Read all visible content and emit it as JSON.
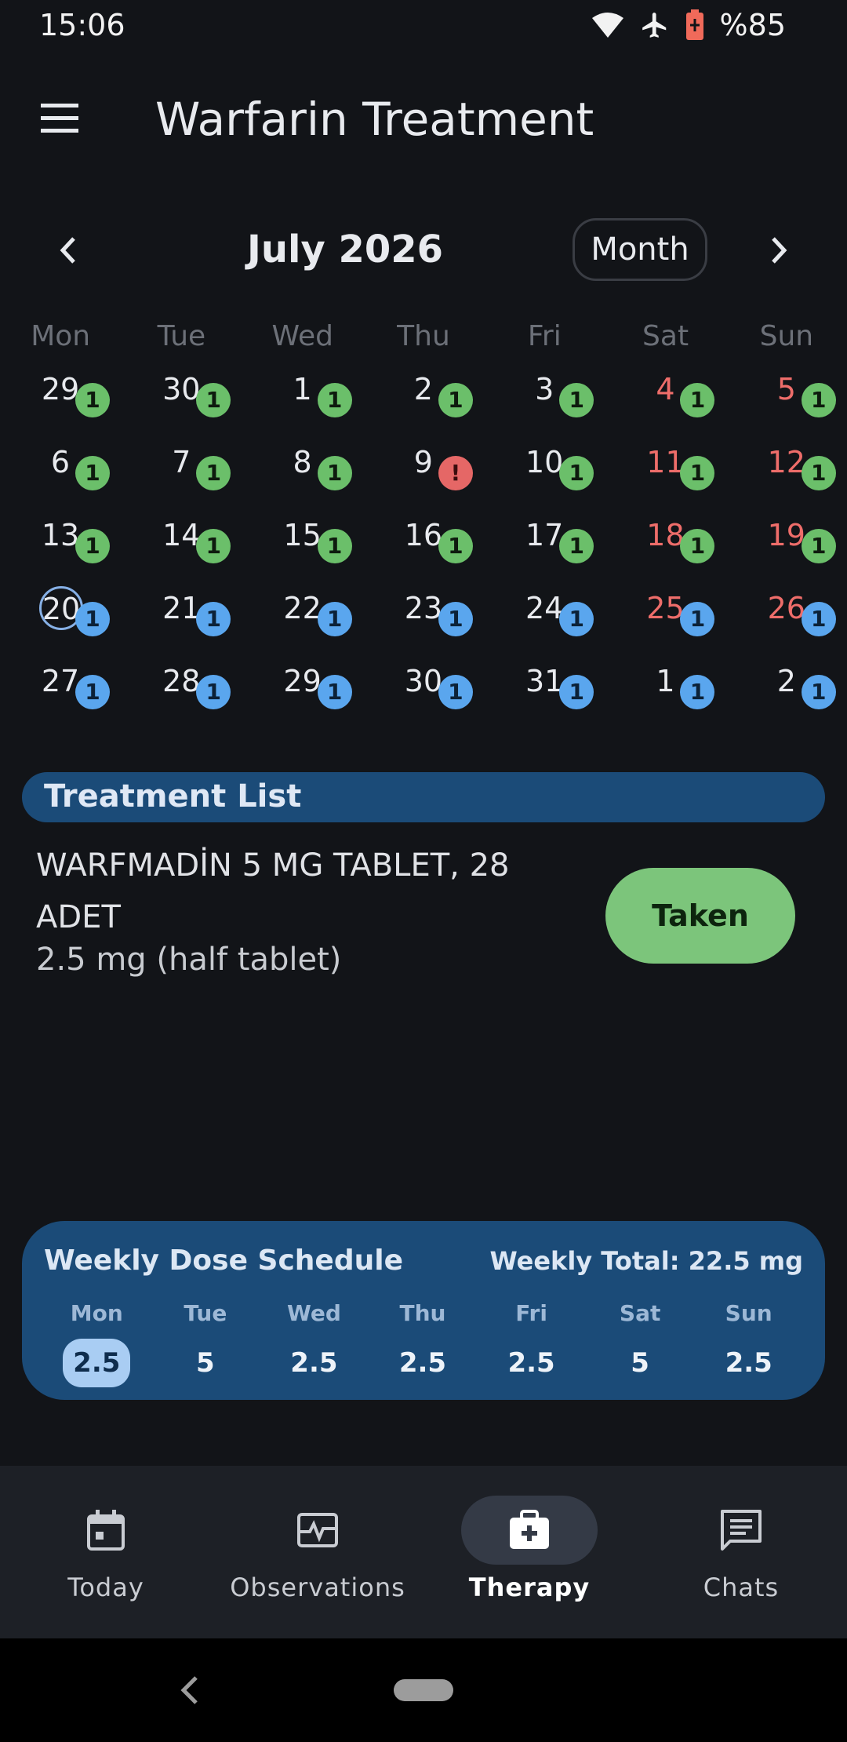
{
  "status_bar": {
    "time": "15:06",
    "battery": "%85"
  },
  "app_bar": {
    "title": "Warfarin Treatment"
  },
  "calendar": {
    "month_label": "July 2026",
    "view_toggle": "Month",
    "weekdays": [
      "Mon",
      "Tue",
      "Wed",
      "Thu",
      "Fri",
      "Sat",
      "Sun"
    ],
    "weeks": [
      [
        {
          "day": "29",
          "badge": "1",
          "status": "taken"
        },
        {
          "day": "30",
          "badge": "1",
          "status": "taken"
        },
        {
          "day": "1",
          "badge": "1",
          "status": "taken"
        },
        {
          "day": "2",
          "badge": "1",
          "status": "taken"
        },
        {
          "day": "3",
          "badge": "1",
          "status": "taken"
        },
        {
          "day": "4",
          "badge": "1",
          "status": "taken",
          "weekend": true
        },
        {
          "day": "5",
          "badge": "1",
          "status": "taken",
          "weekend": true
        }
      ],
      [
        {
          "day": "6",
          "badge": "1",
          "status": "taken"
        },
        {
          "day": "7",
          "badge": "1",
          "status": "taken"
        },
        {
          "day": "8",
          "badge": "1",
          "status": "taken"
        },
        {
          "day": "9",
          "badge": "!",
          "status": "missed"
        },
        {
          "day": "10",
          "badge": "1",
          "status": "taken"
        },
        {
          "day": "11",
          "badge": "1",
          "status": "taken",
          "weekend": true
        },
        {
          "day": "12",
          "badge": "1",
          "status": "taken",
          "weekend": true
        }
      ],
      [
        {
          "day": "13",
          "badge": "1",
          "status": "taken"
        },
        {
          "day": "14",
          "badge": "1",
          "status": "taken"
        },
        {
          "day": "15",
          "badge": "1",
          "status": "taken"
        },
        {
          "day": "16",
          "badge": "1",
          "status": "taken"
        },
        {
          "day": "17",
          "badge": "1",
          "status": "taken"
        },
        {
          "day": "18",
          "badge": "1",
          "status": "taken",
          "weekend": true
        },
        {
          "day": "19",
          "badge": "1",
          "status": "taken",
          "weekend": true
        }
      ],
      [
        {
          "day": "20",
          "badge": "1",
          "status": "planned",
          "today": true
        },
        {
          "day": "21",
          "badge": "1",
          "status": "planned"
        },
        {
          "day": "22",
          "badge": "1",
          "status": "planned"
        },
        {
          "day": "23",
          "badge": "1",
          "status": "planned"
        },
        {
          "day": "24",
          "badge": "1",
          "status": "planned"
        },
        {
          "day": "25",
          "badge": "1",
          "status": "planned",
          "weekend": true
        },
        {
          "day": "26",
          "badge": "1",
          "status": "planned",
          "weekend": true
        }
      ],
      [
        {
          "day": "27",
          "badge": "1",
          "status": "planned"
        },
        {
          "day": "28",
          "badge": "1",
          "status": "planned"
        },
        {
          "day": "29",
          "badge": "1",
          "status": "planned"
        },
        {
          "day": "30",
          "badge": "1",
          "status": "planned"
        },
        {
          "day": "31",
          "badge": "1",
          "status": "planned"
        },
        {
          "day": "1",
          "badge": "1",
          "status": "planned"
        },
        {
          "day": "2",
          "badge": "1",
          "status": "planned"
        }
      ]
    ]
  },
  "treatment": {
    "header": "Treatment List",
    "drug_name": "WARFMADİN 5 MG TABLET, 28 ADET",
    "dose": "2.5 mg (half tablet)",
    "taken_label": "Taken"
  },
  "weekly": {
    "title": "Weekly Dose Schedule",
    "total": "Weekly Total: 22.5 mg",
    "days": [
      {
        "label": "Mon",
        "value": "2.5",
        "selected": true
      },
      {
        "label": "Tue",
        "value": "5"
      },
      {
        "label": "Wed",
        "value": "2.5"
      },
      {
        "label": "Thu",
        "value": "2.5"
      },
      {
        "label": "Fri",
        "value": "2.5"
      },
      {
        "label": "Sat",
        "value": "5"
      },
      {
        "label": "Sun",
        "value": "2.5"
      }
    ]
  },
  "bottom_nav": {
    "items": [
      {
        "label": "Today",
        "icon": "calendar-icon"
      },
      {
        "label": "Observations",
        "icon": "vitals-icon"
      },
      {
        "label": "Therapy",
        "icon": "medical-kit-icon",
        "active": true
      },
      {
        "label": "Chats",
        "icon": "chat-icon"
      }
    ]
  },
  "colors": {
    "background": "#121418",
    "accent_blue": "#1b4b78",
    "taken_green": "#6bbf6a",
    "planned_blue": "#5aa6ee",
    "missed_red": "#e56766",
    "weekend_red": "#ee6d6a"
  }
}
